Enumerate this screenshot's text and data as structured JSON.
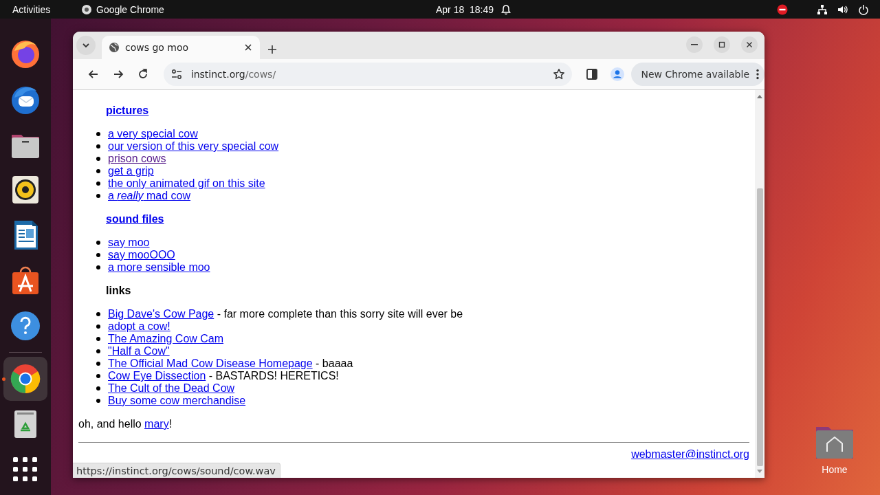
{
  "top_bar": {
    "activities": "Activities",
    "app_name": "Google Chrome",
    "clock": "Apr 18  18:49"
  },
  "dock": {
    "items": [
      {
        "kind": "firefox",
        "running": false
      },
      {
        "kind": "thunderbird",
        "running": false
      },
      {
        "kind": "files",
        "running": false
      },
      {
        "kind": "rhythmbox",
        "running": false
      },
      {
        "kind": "writer",
        "running": false
      },
      {
        "kind": "appcenter",
        "running": false
      },
      {
        "kind": "help",
        "running": false
      },
      {
        "kind": "chrome",
        "running": true
      },
      {
        "kind": "trash",
        "running": false
      },
      {
        "kind": "apps",
        "running": false
      }
    ]
  },
  "desktop": {
    "icons": [
      {
        "label": "Home"
      }
    ]
  },
  "browser": {
    "tabs": [
      {
        "title": "cows go moo",
        "selected": true
      }
    ],
    "address": {
      "host": "instinct.org",
      "path": "/cows/"
    },
    "update_button": "New Chrome available",
    "page": {
      "sections": [
        {
          "heading": "pictures",
          "linked": true,
          "items": [
            {
              "link": "a very special cow",
              "visited": false
            },
            {
              "link": "our version of this very special cow",
              "visited": false
            },
            {
              "link": "prison cows",
              "visited": true
            },
            {
              "link": "get a grip",
              "visited": false
            },
            {
              "link": "the only animated gif on this site",
              "visited": false
            },
            {
              "link": "a *really* mad cow",
              "visited": false
            }
          ]
        },
        {
          "heading": "sound files",
          "linked": true,
          "items": [
            {
              "link": "say moo",
              "visited": false
            },
            {
              "link": "say mooOOO",
              "visited": false
            },
            {
              "link": "a more sensible moo",
              "visited": false
            }
          ]
        },
        {
          "heading": "links",
          "linked": false,
          "items": [
            {
              "link": "Big Dave's Cow Page",
              "visited": false,
              "note": " - far more complete than this sorry site will ever be"
            },
            {
              "link": "adopt a cow!",
              "visited": false
            },
            {
              "link": "The Amazing Cow Cam",
              "visited": false
            },
            {
              "link": "\"Half a Cow\"",
              "visited": false
            },
            {
              "link": "The Official Mad Cow Disease Homepage",
              "visited": false,
              "note": " - baaaa"
            },
            {
              "link": "Cow Eye Dissection",
              "visited": false,
              "note": " - BASTARDS! HERETICS!"
            },
            {
              "link": "The Cult of the Dead Cow",
              "visited": false
            },
            {
              "link": "Buy some cow merchandise",
              "visited": false
            }
          ]
        }
      ],
      "greeting": {
        "before": "oh, and hello ",
        "link": "mary",
        "after": "!"
      },
      "footer_link": "webmaster@instinct.org"
    },
    "status_url": "https://instinct.org/cows/sound/cow.wav"
  }
}
